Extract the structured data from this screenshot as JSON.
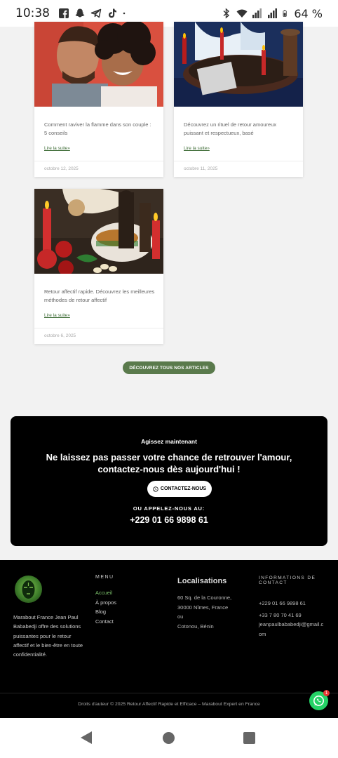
{
  "status_bar": {
    "time": "10:38",
    "battery": "64 %",
    "left_icons": [
      "facebook-icon",
      "snapchat-icon",
      "telegram-icon",
      "tiktok-icon",
      "dot-icon"
    ],
    "right_icons": [
      "bluetooth-icon",
      "wifi-icon",
      "signal-icon",
      "signal-icon",
      "battery-icon"
    ]
  },
  "articles": [
    {
      "excerpt": "Comment raviver la flamme dans son couple : 5 conseils",
      "read_more": "Lire la suite»",
      "date": "octobre 12, 2025"
    },
    {
      "excerpt": "Découvrez un rituel de retour amoureux puissant et respectueux, basé",
      "read_more": "Lire la suite»",
      "date": "octobre 11, 2025"
    },
    {
      "excerpt": "Retour affectif rapide. Découvrez les meilleures méthodes de retour affectif",
      "read_more": "Lire la suite»",
      "date": "octobre 6, 2025"
    }
  ],
  "all_articles_button": "DÉCOUVREZ TOUS NOS ARTICLES",
  "cta": {
    "kicker": "Agissez maintenant",
    "headline": "Ne laissez pas passer votre chance de retrouver l'amour, contactez-nous dès aujourd'hui !",
    "button": "CONTACTEZ-NOUS",
    "call_label": "OU APPELEZ-NOUS AU:",
    "phone": "+229 01 66 9898 61"
  },
  "footer": {
    "about": "Marabout France Jean Paul Bababedji offre des solutions puissantes pour le retour affectif et le bien-être en toute confidentialité.",
    "menu_title": "MENU",
    "menu_items": [
      "Accueil",
      "À propos",
      "Blog",
      "Contact"
    ],
    "localisations_title": "Localisations",
    "localisations": [
      "60 Sq. de la Couronne,",
      "30000 Nîmes, France",
      "ou",
      "Cotonou, Bénin"
    ],
    "info_title": "INFORMATIONS DE CONTACT",
    "phone1": "+229 01 66 9898 61",
    "phone2": "+33 7 80 70 41 69",
    "email": "jeanpaulbababedji@gmail.com",
    "copyright": "Droits d'auteur © 2025 Retour Affectif Rapide et Efficace – Marabout Expert en France"
  },
  "fab_badge": "1",
  "colors": {
    "accent": "#5a7a4c",
    "link": "#3d6b35",
    "whatsapp": "#25d366",
    "footer_bg": "#000000",
    "active_menu": "#7cc26b"
  }
}
